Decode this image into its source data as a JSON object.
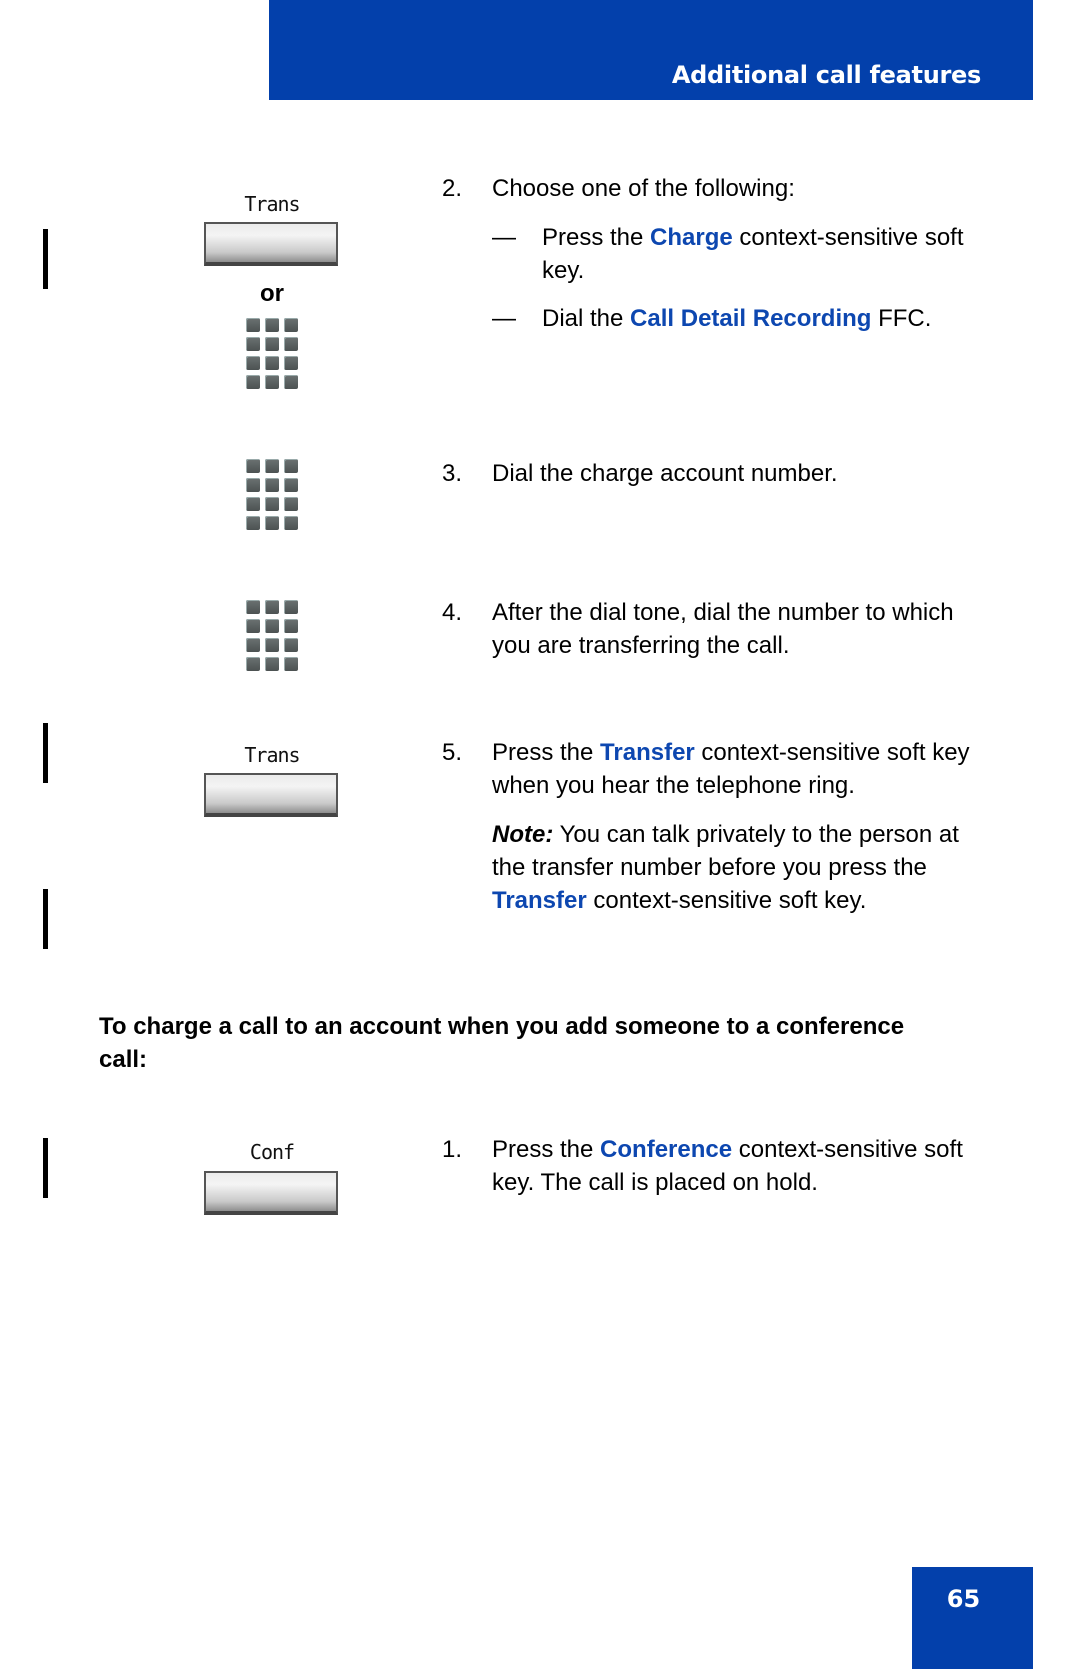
{
  "header": {
    "title": "Additional call features",
    "color": "#0340ab"
  },
  "steps": [
    {
      "number": "2.",
      "text": "Choose one of the following:",
      "icon_label": "Trans",
      "or_label": "or",
      "options": [
        {
          "dash": "—",
          "pre": "Press the ",
          "highlight": "Charge",
          "post": " context-sensitive soft key."
        },
        {
          "dash": "—",
          "pre": "Dial the ",
          "highlight": "Call Detail Recording",
          "post": " FFC."
        }
      ]
    },
    {
      "number": "3.",
      "text": "Dial the charge account number."
    },
    {
      "number": "4.",
      "text": "After the dial tone, dial the number to which you are transferring the call."
    },
    {
      "number": "5.",
      "icon_label": "Trans",
      "pre": "Press the ",
      "highlight": "Transfer",
      "post": " context-sensitive soft key when you hear the telephone ring.",
      "note": {
        "label": "Note:",
        "pre": " You can talk privately to the person at the transfer number before you press the ",
        "highlight": "Transfer",
        "post": " context-sensitive soft key."
      }
    }
  ],
  "subheading": "To charge a call to an account when you add someone to a conference call:",
  "conference_steps": [
    {
      "number": "1.",
      "icon_label": "Conf",
      "pre": "Press the ",
      "highlight": "Conference",
      "post": " context-sensitive soft key. The call is placed on hold."
    }
  ],
  "icons": {
    "softkey": "softkey-button-icon",
    "keypad": "dialpad-icon"
  },
  "highlight_color": "#0d47b0",
  "page_number": "65"
}
